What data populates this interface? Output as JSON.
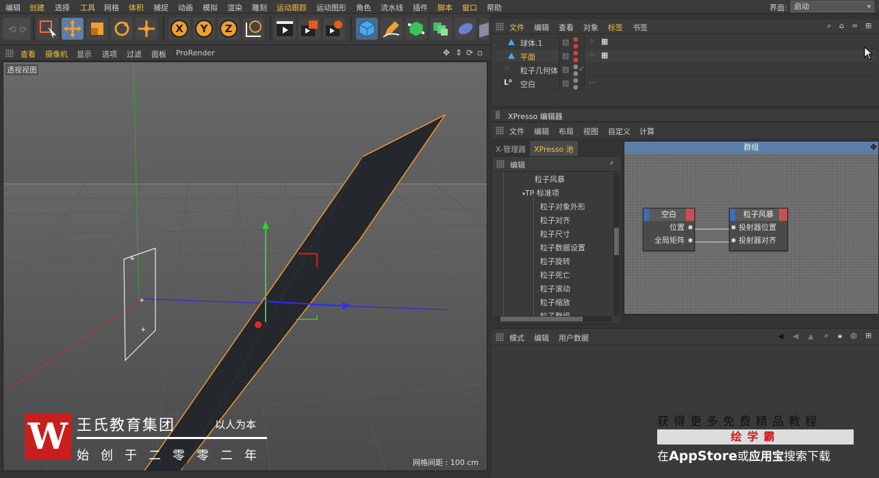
{
  "menubar": {
    "items": [
      "编辑",
      "创建",
      "选择",
      "工具",
      "网格",
      "体积",
      "捕捉",
      "动画",
      "模拟",
      "渲染",
      "雕刻",
      "运动跟踪",
      "运动图形",
      "角色",
      "流水线",
      "插件",
      "脚本",
      "窗口",
      "帮助"
    ],
    "layout_label": "界面:",
    "layout_value": "启动"
  },
  "toolbar": {
    "icons": [
      "undo-icon",
      "live-select-icon",
      "move-icon",
      "scale-icon",
      "rotate-icon",
      "move-all-icon",
      "x-axis-icon",
      "y-axis-icon",
      "z-axis-icon",
      "world-coordinates-icon",
      "render-view-icon",
      "render-picture-viewer-icon",
      "render-settings-icon",
      "cube-icon",
      "pen-icon",
      "subdivision-icon",
      "array-icon",
      "deformer-icon",
      "floor-icon"
    ],
    "axis_x": "X",
    "axis_y": "Y",
    "axis_z": "Z",
    "accent": "#5b7fa8"
  },
  "viewport": {
    "menu": [
      "查看",
      "摄像机",
      "显示",
      "选项",
      "过滤",
      "面板",
      "ProRender"
    ],
    "label": "透视视图",
    "grid_distance": "网格间距 : 100 cm"
  },
  "object_manager": {
    "menu": [
      "文件",
      "编辑",
      "查看",
      "对象",
      "标签",
      "书签"
    ],
    "objects": [
      {
        "name": "球体.1",
        "selected": false
      },
      {
        "name": "平面",
        "selected": true
      },
      {
        "name": "粒子几何体",
        "selected": false
      },
      {
        "name": "空白",
        "selected": false
      }
    ]
  },
  "xpresso": {
    "title": "XPresso 编辑器",
    "menu": [
      "文件",
      "编辑",
      "布局",
      "视图",
      "自定义",
      "计算"
    ],
    "tabs": [
      "X-管理器",
      "XPresso 池"
    ],
    "tree_head": "编辑",
    "tree_items": [
      "粒子风暴",
      "TP 标准项",
      "粒子对象外形",
      "粒子对齐",
      "粒子尺寸",
      "粒子数据设置",
      "粒子旋转",
      "粒子死亡",
      "粒子滚动",
      "粒子缩放",
      "粒子群组"
    ],
    "canvas_title": "群组",
    "nodes": [
      {
        "title": "空白",
        "ports": [
          "位置",
          "全局矩阵"
        ]
      },
      {
        "title": "粒子风暴",
        "ports": [
          "投射器位置",
          "投射器对齐"
        ]
      }
    ]
  },
  "attributes": {
    "menu": [
      "模式",
      "编辑",
      "用户数据"
    ]
  },
  "watermark_left": {
    "logo_letter": "W",
    "company": "王氏教育集团",
    "motto": "以人为本",
    "founded": "始创于二零零二年"
  },
  "watermark_right": {
    "line1": "获得更多免费精品教程",
    "brand": "绘学霸",
    "line3_pre": "在",
    "line3_store": "AppStore",
    "line3_mid": "或",
    "line3_app": "应用宝",
    "line3_post": "搜索下载"
  }
}
